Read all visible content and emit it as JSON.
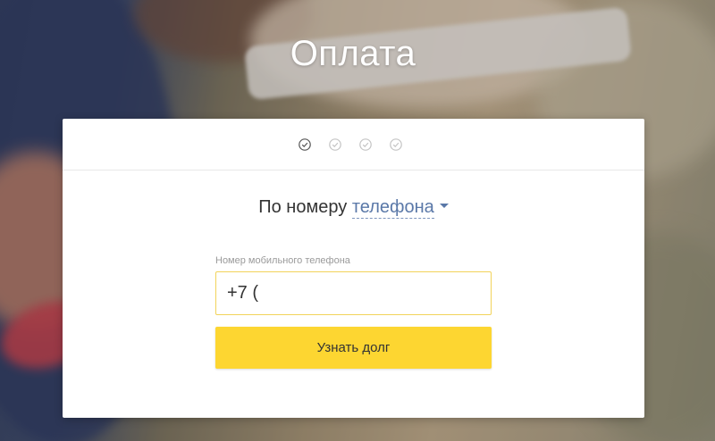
{
  "page": {
    "title": "Оплата"
  },
  "steps": {
    "count": 4,
    "current": 1,
    "icons": [
      "check-circle-icon",
      "check-circle-icon",
      "check-circle-icon",
      "check-circle-icon"
    ]
  },
  "method": {
    "lead_text": "По номеру",
    "selected": "телефона",
    "caret_icon": "caret-down-icon"
  },
  "phone": {
    "label": "Номер мобильного телефона",
    "value": "+7 ("
  },
  "actions": {
    "submit_label": "Узнать долг"
  },
  "colors": {
    "accent_yellow": "#fdd631",
    "input_border": "#f2d35a",
    "link_blue": "#5a78a8",
    "step_active": "#555555",
    "step_inactive": "#c4c4c4"
  }
}
